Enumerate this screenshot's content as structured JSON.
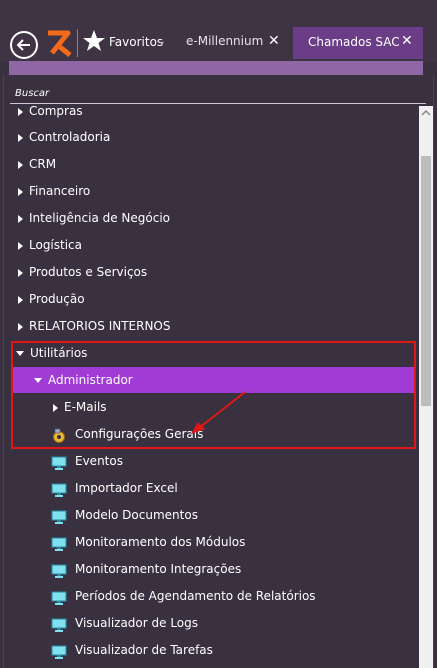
{
  "header": {
    "favorites_label": "Favoritos",
    "tabs": [
      {
        "label": "e-Millennium",
        "active": false
      },
      {
        "label": "Chamados SAC",
        "active": true
      }
    ],
    "close_glyph": "✕"
  },
  "search": {
    "label": "Buscar"
  },
  "tree": {
    "top_items": [
      "Compras",
      "Controladoria",
      "CRM",
      "Financeiro",
      "Inteligência de Negócio",
      "Logística",
      "Produtos e Serviços",
      "Produção",
      "RELATORIOS INTERNOS"
    ],
    "utilitarios": "Utilitários",
    "administrador": "Administrador",
    "emails": "E-Mails",
    "config": "Configurações Gerais",
    "leaves": [
      "Eventos",
      "Importador Excel",
      "Modelo Documentos",
      "Monitoramento dos Módulos",
      "Monitoramento Integrações",
      "Períodos de Agendamento de Relatórios",
      "Visualizador de Logs",
      "Visualizador de Tarefas"
    ]
  },
  "colors": {
    "accent": "#a03bd6",
    "highlight_border": "#e01717",
    "tab_active": "#6b3d87",
    "background": "#3a3140"
  }
}
